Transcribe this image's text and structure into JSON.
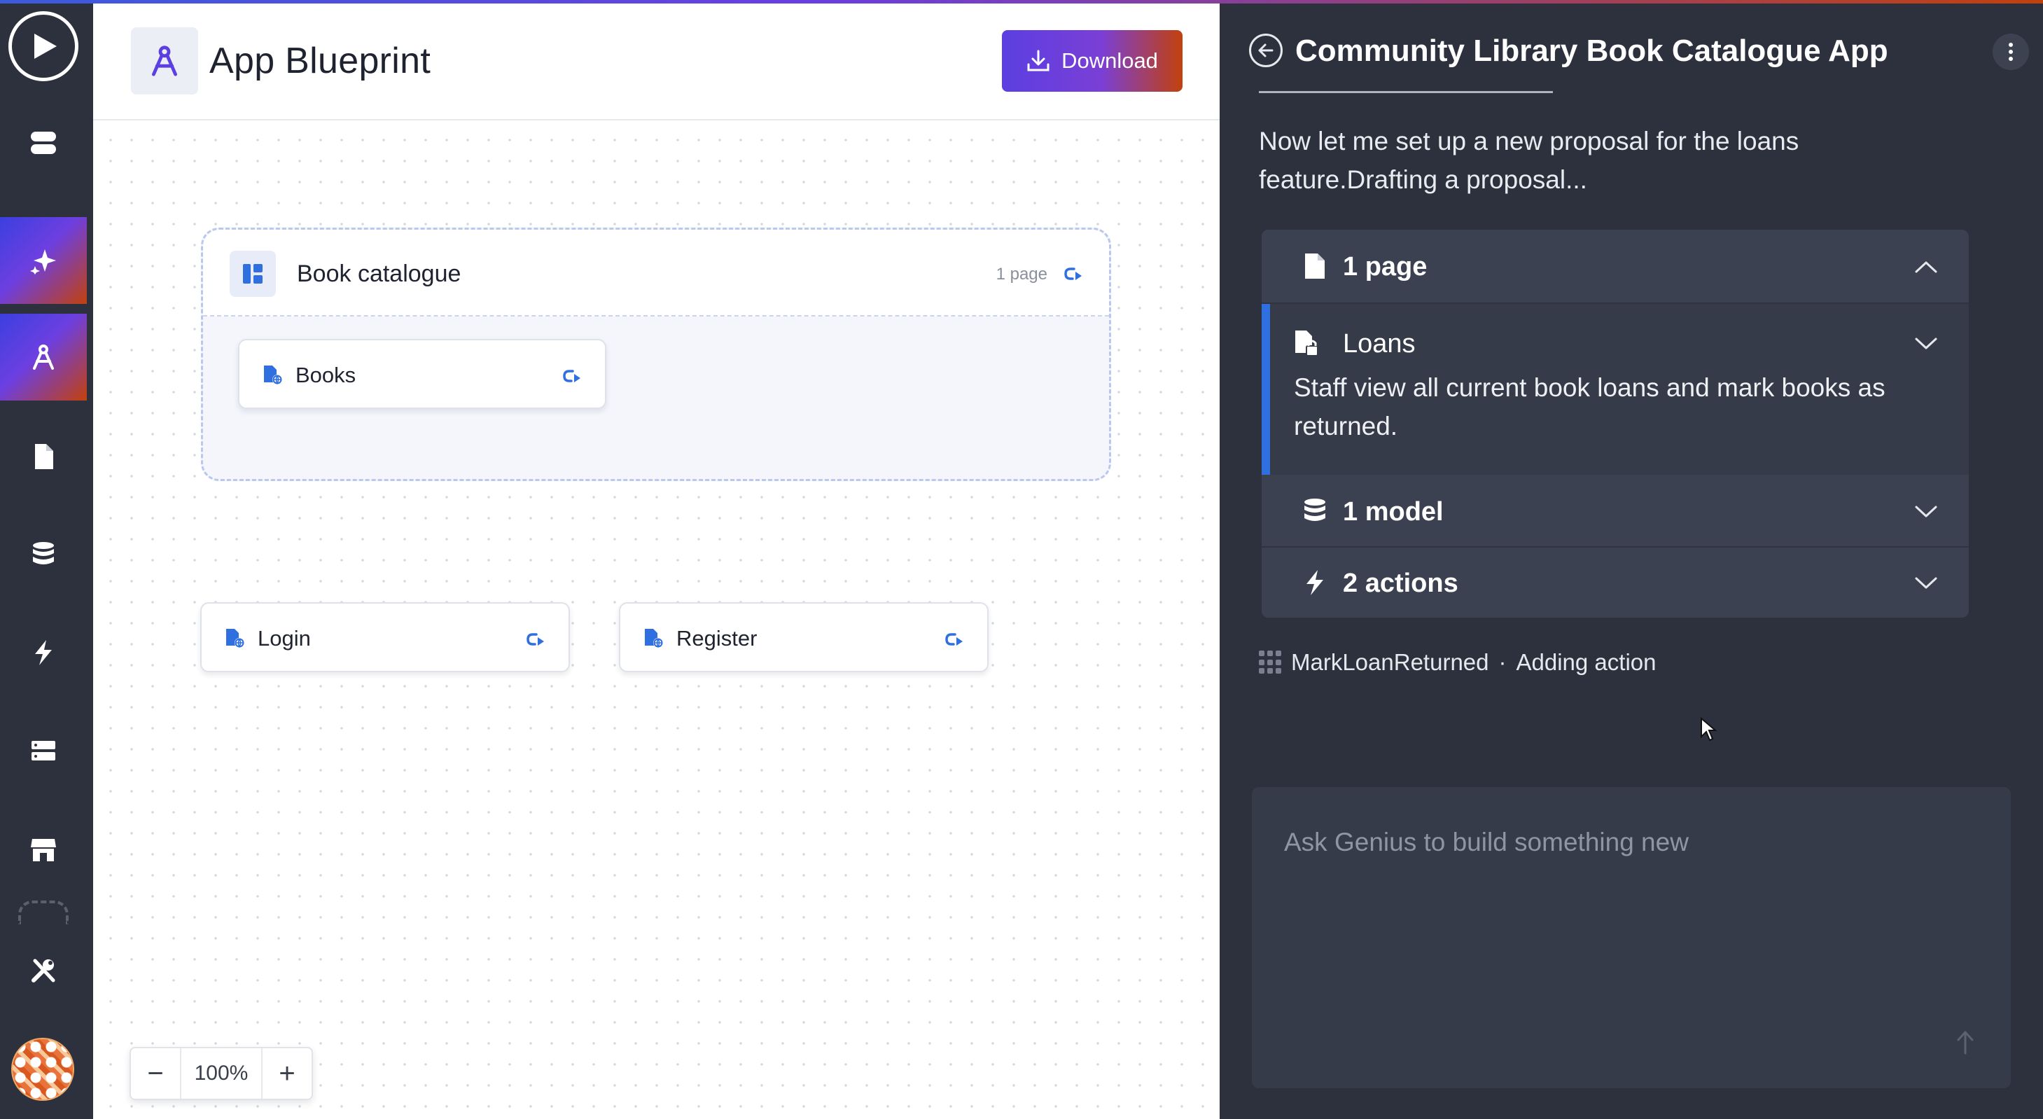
{
  "canvas": {
    "title": "App Blueprint",
    "download_label": "Download",
    "group": {
      "title": "Book catalogue",
      "page_count": "1 page",
      "pages": [
        {
          "label": "Books"
        }
      ]
    },
    "standalone_pages": [
      {
        "label": "Login"
      },
      {
        "label": "Register"
      }
    ],
    "zoom": {
      "value": "100%",
      "minus": "−",
      "plus": "+"
    }
  },
  "rail": {
    "items": [
      "play-icon",
      "layers-icon",
      "sparkle-icon",
      "blueprint-icon",
      "page-icon",
      "database-icon",
      "bolt-icon",
      "server-icon",
      "store-icon",
      "tools-icon"
    ],
    "active": [
      "sparkle-icon",
      "blueprint-icon"
    ]
  },
  "panel": {
    "title": "Community Library Book Catalogue App",
    "message": "Now let me set up a new proposal for the loans feature.Drafting a proposal...",
    "proposal": {
      "pages_label": "1 page",
      "page_item": {
        "label": "Loans",
        "description": "Staff view all current book loans and mark books as returned."
      },
      "models_label": "1 model",
      "actions_label": "2 actions"
    },
    "status": {
      "name": "MarkLoanReturned",
      "separator": "·",
      "text": "Adding action"
    },
    "composer_placeholder": "Ask Genius to build something new"
  },
  "colors": {
    "accent_blue": "#3b5bdb",
    "accent_purple": "#6a3fe0",
    "accent_orange": "#c2410c",
    "link_blue": "#2f6fe0"
  }
}
